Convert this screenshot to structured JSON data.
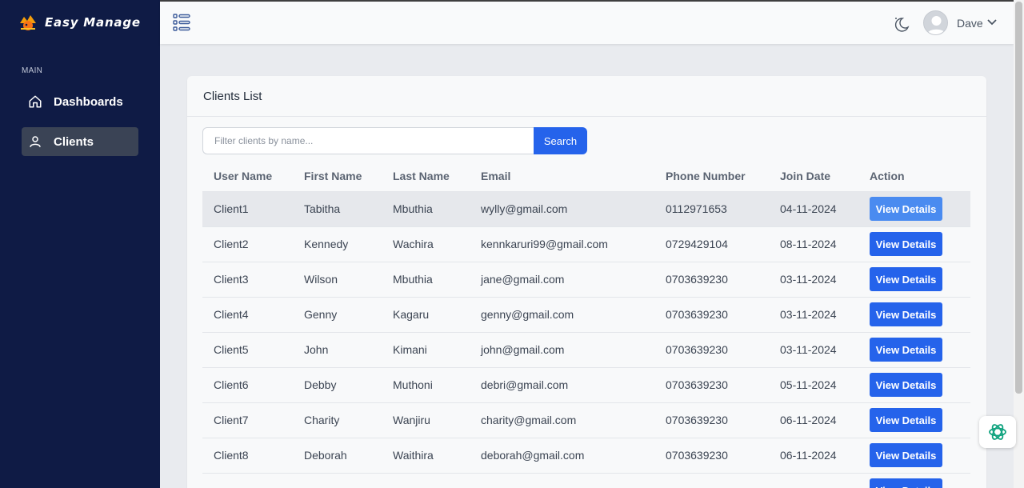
{
  "brand": {
    "name": "Easy Manage"
  },
  "sidebar": {
    "section_label": "MAIN",
    "items": [
      {
        "label": "Dashboards",
        "icon": "home-icon",
        "active": false
      },
      {
        "label": "Clients",
        "icon": "user-icon",
        "active": true
      }
    ]
  },
  "topbar": {
    "user_name": "Dave"
  },
  "card": {
    "title": "Clients List"
  },
  "search": {
    "placeholder": "Filter clients by name...",
    "button_label": "Search"
  },
  "table": {
    "headers": [
      "User Name",
      "First Name",
      "Last Name",
      "Email",
      "Phone Number",
      "Join Date",
      "Action"
    ],
    "action_label": "View Details",
    "rows": [
      {
        "username": "Client1",
        "first": "Tabitha",
        "last": "Mbuthia",
        "email": "wylly@gmail.com",
        "phone": "0112971653",
        "join": "04-11-2024"
      },
      {
        "username": "Client2",
        "first": "Kennedy",
        "last": "Wachira",
        "email": "kennkaruri99@gmail.com",
        "phone": "0729429104",
        "join": "08-11-2024"
      },
      {
        "username": "Client3",
        "first": "Wilson",
        "last": "Mbuthia",
        "email": "jane@gmail.com",
        "phone": "0703639230",
        "join": "03-11-2024"
      },
      {
        "username": "Client4",
        "first": "Genny",
        "last": "Kagaru",
        "email": "genny@gmail.com",
        "phone": "0703639230",
        "join": "03-11-2024"
      },
      {
        "username": "Client5",
        "first": "John",
        "last": "Kimani",
        "email": "john@gmail.com",
        "phone": "0703639230",
        "join": "03-11-2024"
      },
      {
        "username": "Client6",
        "first": "Debby",
        "last": "Muthoni",
        "email": "debri@gmail.com",
        "phone": "0703639230",
        "join": "05-11-2024"
      },
      {
        "username": "Client7",
        "first": "Charity",
        "last": "Wanjiru",
        "email": "charity@gmail.com",
        "phone": "0703639230",
        "join": "06-11-2024"
      },
      {
        "username": "Client8",
        "first": "Deborah",
        "last": "Waithira",
        "email": "deborah@gmail.com",
        "phone": "0703639230",
        "join": "06-11-2024"
      },
      {
        "username": "",
        "first": "",
        "last": "",
        "email": "",
        "phone": "",
        "join": ""
      }
    ]
  },
  "colors": {
    "sidebar_bg": "#0f1b45",
    "primary": "#2563eb",
    "highlight_row": "#e6e8ec"
  }
}
